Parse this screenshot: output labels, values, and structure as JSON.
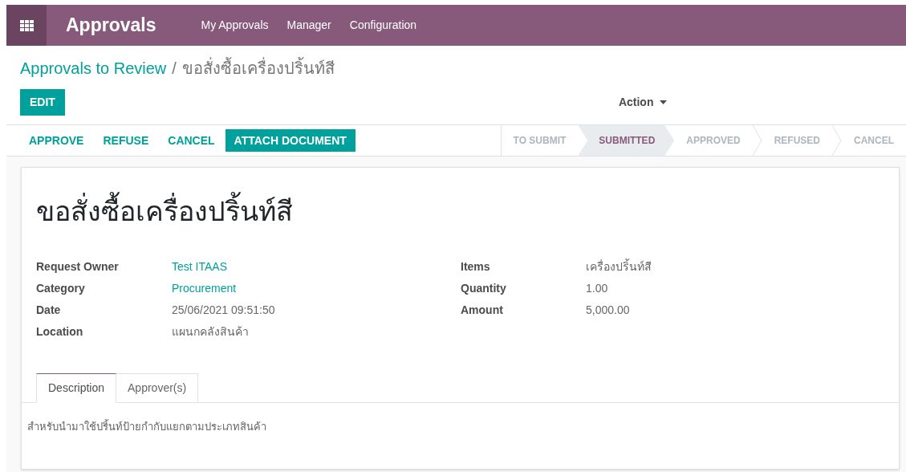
{
  "navbar": {
    "app_title": "Approvals",
    "menu": [
      {
        "label": "My Approvals"
      },
      {
        "label": "Manager"
      },
      {
        "label": "Configuration"
      }
    ]
  },
  "breadcrumb": {
    "parent": "Approvals to Review",
    "separator": "/",
    "current": "ขอสั่งซื้อเครื่องปริ้นท์สี"
  },
  "edit_button": "EDIT",
  "action_menu": "Action",
  "action_buttons": [
    {
      "label": "APPROVE",
      "kind": "link"
    },
    {
      "label": "REFUSE",
      "kind": "link"
    },
    {
      "label": "CANCEL",
      "kind": "link"
    },
    {
      "label": "ATTACH DOCUMENT",
      "kind": "primary"
    }
  ],
  "stages": [
    {
      "label": "TO SUBMIT",
      "selected": false
    },
    {
      "label": "SUBMITTED",
      "selected": true
    },
    {
      "label": "APPROVED",
      "selected": false
    },
    {
      "label": "REFUSED",
      "selected": false
    },
    {
      "label": "CANCEL",
      "selected": false
    }
  ],
  "record": {
    "title": "ขอสั่งซื้อเครื่องปริ้นท์สี",
    "left_fields": [
      {
        "label": "Request Owner",
        "value": "Test ITAAS",
        "kind": "link"
      },
      {
        "label": "Category",
        "value": "Procurement",
        "kind": "link"
      },
      {
        "label": "Date",
        "value": "25/06/2021 09:51:50",
        "kind": "text"
      },
      {
        "label": "Location",
        "value": "แผนกคลังสินค้า",
        "kind": "text"
      }
    ],
    "right_fields": [
      {
        "label": "Items",
        "value": "เครื่องปริ้นท์สี",
        "kind": "text"
      },
      {
        "label": "Quantity",
        "value": "1.00",
        "kind": "text"
      },
      {
        "label": "Amount",
        "value": "5,000.00",
        "kind": "text"
      }
    ],
    "tabs": [
      {
        "label": "Description",
        "selected": true
      },
      {
        "label": "Approver(s)",
        "selected": false
      }
    ],
    "description": "สำหรับนำมาใช้ปริ้นท์ป้ายกำกับแยกตามประเภทสินค้า"
  }
}
